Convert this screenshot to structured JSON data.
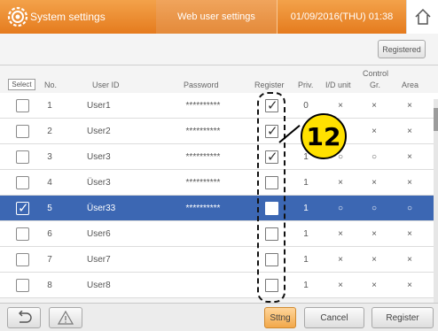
{
  "header": {
    "system_settings": "System settings",
    "web_user_settings": "Web user settings",
    "datetime": "01/09/2016(THU) 01:38",
    "gear_icon": "gear-icon",
    "home_icon": "home-icon"
  },
  "toolbar": {
    "registered_label": "Registered"
  },
  "columns": {
    "select": "Select",
    "no": "No.",
    "user_id": "User ID",
    "password": "Password",
    "register": "Register",
    "priv": "Priv.",
    "control": "Control",
    "idu": "I/D unit",
    "gr": "Gr.",
    "area": "Area"
  },
  "rows": [
    {
      "no": "1",
      "user": "User1",
      "pw": "**********",
      "reg": true,
      "priv": "0",
      "idu": "×",
      "gr": "×",
      "area": "×",
      "selected": false
    },
    {
      "no": "2",
      "user": "User2",
      "pw": "**********",
      "reg": true,
      "priv": "",
      "idu": "",
      "gr": "×",
      "area": "×",
      "selected": false
    },
    {
      "no": "3",
      "user": "User3",
      "pw": "**********",
      "reg": true,
      "priv": "1",
      "idu": "○",
      "gr": "○",
      "area": "×",
      "selected": false
    },
    {
      "no": "4",
      "user": "Üser3",
      "pw": "**********",
      "reg": false,
      "priv": "1",
      "idu": "×",
      "gr": "×",
      "area": "×",
      "selected": false
    },
    {
      "no": "5",
      "user": "Üser33",
      "pw": "**********",
      "reg": false,
      "priv": "1",
      "idu": "○",
      "gr": "○",
      "area": "○",
      "selected": true
    },
    {
      "no": "6",
      "user": "User6",
      "pw": "",
      "reg": false,
      "priv": "1",
      "idu": "×",
      "gr": "×",
      "area": "×",
      "selected": false
    },
    {
      "no": "7",
      "user": "User7",
      "pw": "",
      "reg": false,
      "priv": "1",
      "idu": "×",
      "gr": "×",
      "area": "×",
      "selected": false
    },
    {
      "no": "8",
      "user": "User8",
      "pw": "",
      "reg": false,
      "priv": "1",
      "idu": "×",
      "gr": "×",
      "area": "×",
      "selected": false
    }
  ],
  "callout": {
    "number": "12"
  },
  "bottom": {
    "back_icon": "back-icon",
    "warning_icon": "warning-icon",
    "sttng": "Sttng",
    "cancel": "Cancel",
    "register": "Register"
  },
  "colors": {
    "header_orange": "#e57b1e",
    "selected_row": "#3c67b3",
    "callout_yellow": "#ffe100"
  }
}
